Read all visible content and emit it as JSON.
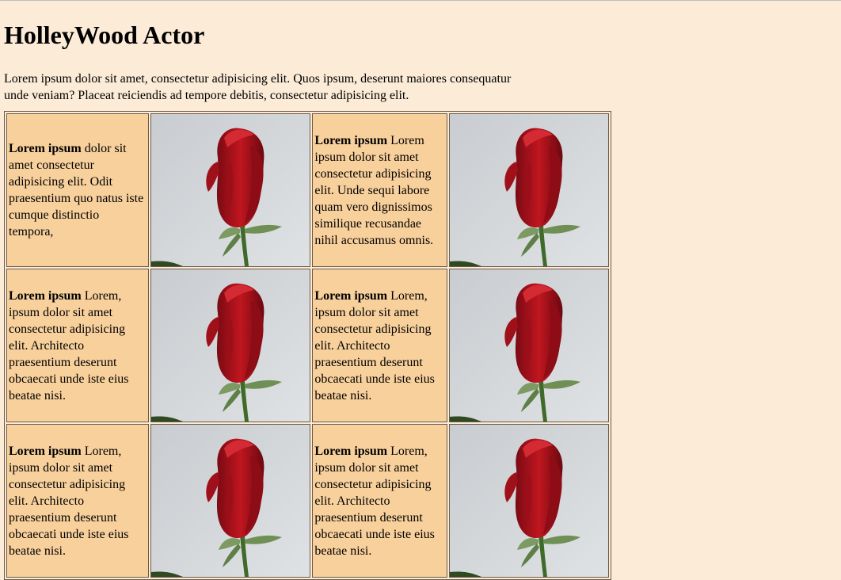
{
  "page": {
    "title": "HolleyWood Actor",
    "intro": "Lorem ipsum dolor sit amet, consectetur adipisicing elit. Quos ipsum, deserunt maiores consequatur unde veniam? Placeat reiciendis ad tempore debitis, consectetur adipisicing elit."
  },
  "cells": [
    {
      "bold": "Lorem ipsum",
      "text": " dolor sit amet consectetur adipisicing elit. Odit praesentium quo natus iste cumque distinctio tempora,"
    },
    {
      "bold": "Lorem ipsum",
      "text": " Lorem ipsum dolor sit amet consectetur adipisicing elit. Unde sequi labore quam vero dignissimos similique recusandae nihil accusamus omnis."
    },
    {
      "bold": "Lorem ipsum",
      "text": " Lorem, ipsum dolor sit amet consectetur adipisicing elit. Architecto praesentium deserunt obcaecati unde iste eius beatae nisi."
    },
    {
      "bold": "Lorem ipsum",
      "text": " Lorem, ipsum dolor sit amet consectetur adipisicing elit. Architecto praesentium deserunt obcaecati unde iste eius beatae nisi."
    },
    {
      "bold": "Lorem ipsum",
      "text": " Lorem, ipsum dolor sit amet consectetur adipisicing elit. Architecto praesentium deserunt obcaecati unde iste eius beatae nisi."
    },
    {
      "bold": "Lorem ipsum",
      "text": " Lorem, ipsum dolor sit amet consectetur adipisicing elit. Architecto praesentium deserunt obcaecati unde iste eius beatae nisi."
    }
  ],
  "image": {
    "subject": "red-rose-photo"
  },
  "colors": {
    "background": "#fbebd7",
    "cell": "#f8d09c",
    "rose": "#b1121d"
  }
}
